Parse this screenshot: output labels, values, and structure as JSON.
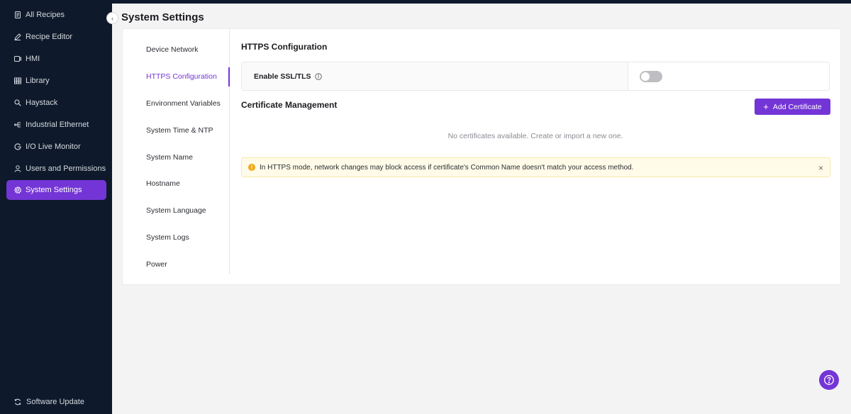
{
  "sidebar": {
    "items": [
      {
        "label": "All Recipes",
        "icon": "document-icon"
      },
      {
        "label": "Recipe Editor",
        "icon": "pencil-icon"
      },
      {
        "label": "HMI",
        "icon": "monitor-icon"
      },
      {
        "label": "Library",
        "icon": "grid-icon"
      },
      {
        "label": "Haystack",
        "icon": "search-icon"
      },
      {
        "label": "Industrial Ethernet",
        "icon": "network-icon"
      },
      {
        "label": "I/O Live Monitor",
        "icon": "gauge-icon"
      },
      {
        "label": "Users and Permissions",
        "icon": "user-icon"
      },
      {
        "label": "System Settings",
        "icon": "gear-icon"
      }
    ],
    "active": "System Settings",
    "footer": {
      "label": "Software Update",
      "icon": "refresh-icon"
    }
  },
  "page": {
    "title": "System Settings"
  },
  "subnav": {
    "items": [
      "Device Network",
      "HTTPS Configuration",
      "Environment Variables",
      "System Time & NTP",
      "System Name",
      "Hostname",
      "System Language",
      "System Logs",
      "Power"
    ],
    "active": "HTTPS Configuration"
  },
  "https": {
    "section_title": "HTTPS Configuration",
    "ssl_label": "Enable SSL/TLS",
    "ssl_enabled": false
  },
  "certificates": {
    "title": "Certificate Management",
    "add_button": "Add Certificate",
    "empty_text": "No certificates available. Create or import a new one."
  },
  "warning": {
    "text": "In HTTPS mode, network changes may block access if certificate's Common Name doesn't match your access method."
  },
  "colors": {
    "accent": "#7435d6",
    "sidebar_bg": "#0e1a2b",
    "warning_bg": "#fffbe8",
    "warning_icon": "#f0a81a"
  }
}
